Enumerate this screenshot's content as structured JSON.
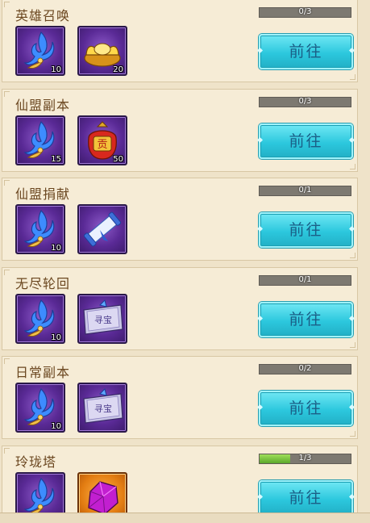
{
  "tasks": [
    {
      "title": "英雄召唤",
      "progress_text": "0/3",
      "progress": 0.0,
      "button_label": "前往",
      "rewards": [
        {
          "icon": "blue-feather-icon",
          "count": "10"
        },
        {
          "icon": "gold-ingot-icon",
          "count": "20"
        }
      ]
    },
    {
      "title": "仙盟副本",
      "progress_text": "0/3",
      "progress": 0.0,
      "button_label": "前往",
      "rewards": [
        {
          "icon": "blue-feather-icon",
          "count": "15"
        },
        {
          "icon": "contribution-pouch-icon",
          "count": "50"
        }
      ]
    },
    {
      "title": "仙盟捐献",
      "progress_text": "0/1",
      "progress": 0.0,
      "button_label": "前往",
      "rewards": [
        {
          "icon": "blue-feather-icon",
          "count": "10"
        },
        {
          "icon": "scroll-icon",
          "count": ""
        }
      ]
    },
    {
      "title": "无尽轮回",
      "progress_text": "0/1",
      "progress": 0.0,
      "button_label": "前往",
      "rewards": [
        {
          "icon": "blue-feather-icon",
          "count": "10"
        },
        {
          "icon": "treasure-book-icon",
          "count": ""
        }
      ]
    },
    {
      "title": "日常副本",
      "progress_text": "0/2",
      "progress": 0.0,
      "button_label": "前往",
      "rewards": [
        {
          "icon": "blue-feather-icon",
          "count": "10"
        },
        {
          "icon": "treasure-book-icon",
          "count": ""
        }
      ]
    },
    {
      "title": "玲珑塔",
      "progress_text": "1/3",
      "progress": 0.333,
      "button_label": "前往",
      "rewards": [
        {
          "icon": "blue-feather-icon",
          "count": ""
        },
        {
          "icon": "purple-gem-icon",
          "count": ""
        }
      ]
    }
  ],
  "book_text": "寻宝",
  "pouch_text": "贡",
  "colors": {
    "progress_fill": "#7ccc3c",
    "button": "#2cc8de",
    "title": "#6b4720"
  }
}
